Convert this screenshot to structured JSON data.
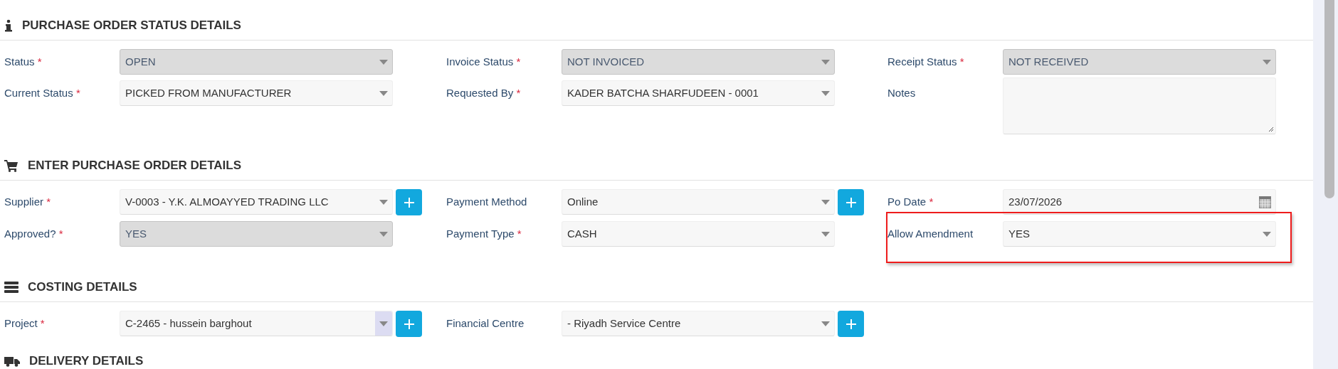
{
  "sections": [
    {
      "title": "PURCHASE ORDER STATUS DETAILS",
      "fields": [
        {
          "label": "Status",
          "required_mark": "*",
          "kind": "select",
          "value": "OPEN",
          "disabled": true
        },
        {
          "label": "Invoice Status",
          "required_mark": "*",
          "kind": "select",
          "value": "NOT INVOICED",
          "disabled": true
        },
        {
          "label": "Receipt Status",
          "required_mark": "*",
          "kind": "select",
          "value": "NOT RECEIVED",
          "disabled": true
        },
        {
          "label": "Current Status",
          "required_mark": "*",
          "kind": "select",
          "value": "PICKED FROM MANUFACTURER",
          "disabled": false
        },
        {
          "label": "Requested By",
          "required_mark": "*",
          "kind": "select",
          "value": "KADER BATCHA SHARFUDEEN - 0001",
          "disabled": false
        },
        {
          "label": "Notes",
          "kind": "textarea",
          "disabled": false
        }
      ]
    },
    {
      "title": "ENTER PURCHASE ORDER DETAILS",
      "fields": [
        {
          "label": "Supplier",
          "required_mark": "*",
          "kind": "select",
          "value": "V-0003 - Y.K. ALMOAYYED TRADING LLC",
          "disabled": false,
          "add_button": true
        },
        {
          "label": "Payment Method",
          "kind": "select",
          "value": "Online",
          "disabled": false,
          "add_button": true
        },
        {
          "label": "Po Date",
          "required_mark": "*",
          "kind": "date",
          "value": "23/07/2026",
          "disabled": false
        },
        {
          "label": "Approved?",
          "required_mark": "*",
          "kind": "select",
          "value": "YES",
          "disabled": true
        },
        {
          "label": "Payment Type",
          "required_mark": "*",
          "kind": "select",
          "value": "CASH",
          "disabled": false
        },
        {
          "label": "Allow Amendment",
          "kind": "select",
          "value": "YES",
          "disabled": false,
          "highlighted": true
        }
      ]
    },
    {
      "title": "COSTING DETAILS",
      "fields": [
        {
          "label": "Project",
          "required_mark": "*",
          "kind": "select",
          "value": "C-2465 - hussein barghout",
          "disabled": false,
          "add_button": true,
          "focused": true
        },
        {
          "label": "Financial Centre",
          "kind": "select",
          "value": "- Riyadh Service Centre",
          "disabled": false,
          "add_button": true
        }
      ]
    },
    {
      "title": "DELIVERY DETAILS"
    }
  ]
}
